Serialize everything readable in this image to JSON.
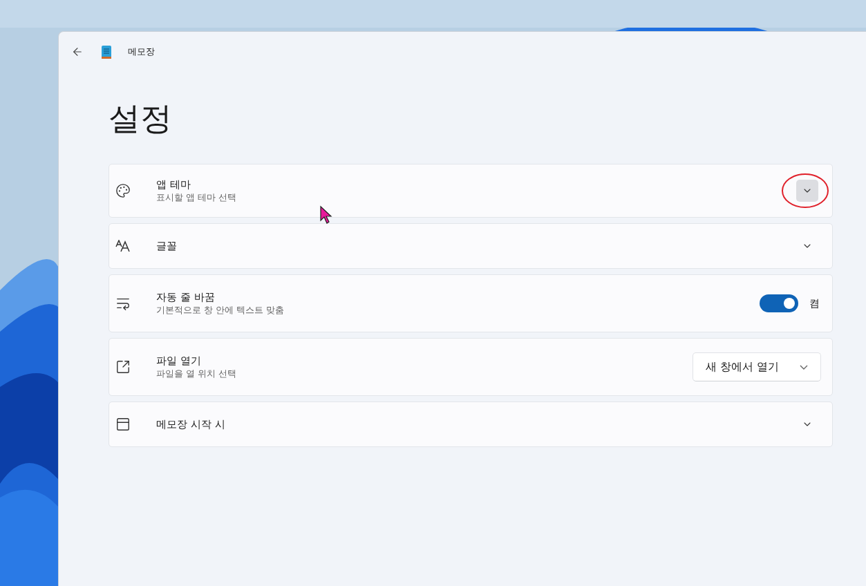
{
  "window": {
    "title": "메모장"
  },
  "page_title": "설정",
  "settings": [
    {
      "kind": "expander",
      "title": "앱 테마",
      "subtitle": "표시할 앱 테마 선택",
      "hovered": true,
      "annotated": true
    },
    {
      "kind": "expander",
      "title": "글꼴",
      "hovered": false,
      "annotated": false
    },
    {
      "kind": "toggle",
      "title": "자동 줄 바꿈",
      "subtitle": "기본적으로 창 안에 텍스트 맞춤",
      "on": true,
      "state_label": "켬"
    },
    {
      "kind": "dropdown",
      "title": "파일 열기",
      "subtitle": "파일을 열 위치 선택",
      "value": "새 창에서 열기"
    },
    {
      "kind": "expander",
      "title": "메모장 시작 시",
      "hovered": false,
      "annotated": false
    }
  ]
}
